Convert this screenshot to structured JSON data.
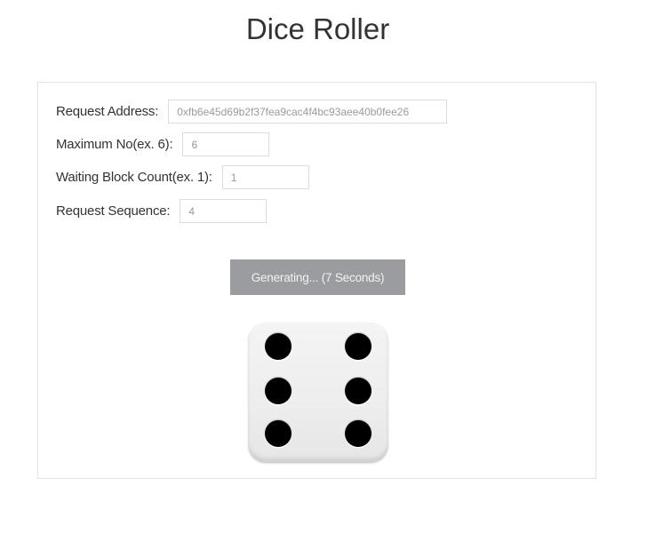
{
  "page": {
    "title": "Dice Roller"
  },
  "form": {
    "fields": [
      {
        "label": "Request Address:",
        "value": "0xfb6e45d69b2f37fea9cac4f4bc93aee40b0fee26"
      },
      {
        "label": "Maximum No(ex. 6):",
        "value": "6"
      },
      {
        "label": "Waiting Block Count(ex. 1):",
        "value": "1"
      },
      {
        "label": "Request Sequence:",
        "value": "4"
      }
    ]
  },
  "button": {
    "label": "Generating... (7 Seconds)",
    "color": "#9b9ca0",
    "state": "disabled"
  },
  "die": {
    "face_value": 6,
    "icon": "dice-six-icon",
    "pip_color": "#000000"
  }
}
